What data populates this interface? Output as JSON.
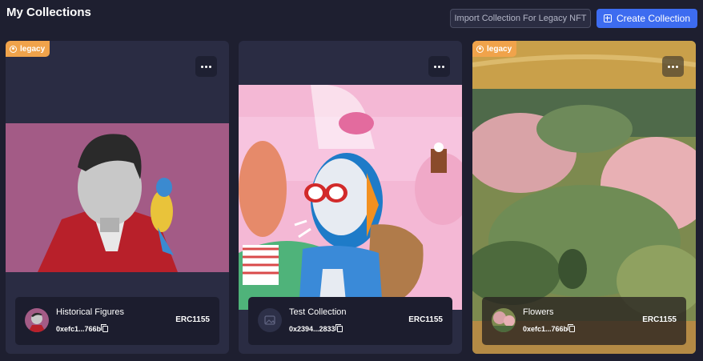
{
  "header": {
    "title": "My Collections",
    "import_label": "Import Collection For Legacy NFT",
    "create_label": "Create Collection"
  },
  "collections": [
    {
      "badge": "legacy",
      "name": "Historical Figures",
      "address": "0xefc1...766b",
      "standard": "ERC1155"
    },
    {
      "name": "Test Collection",
      "address": "0x2394...2833",
      "standard": "ERC1155"
    },
    {
      "badge": "legacy",
      "name": "Flowers",
      "address": "0xefc1...766b",
      "standard": "ERC1155"
    }
  ],
  "colors": {
    "accent": "#3d6cf0",
    "badge": "#f0a34b",
    "background": "#1e1f30",
    "card": "#2a2c43"
  }
}
